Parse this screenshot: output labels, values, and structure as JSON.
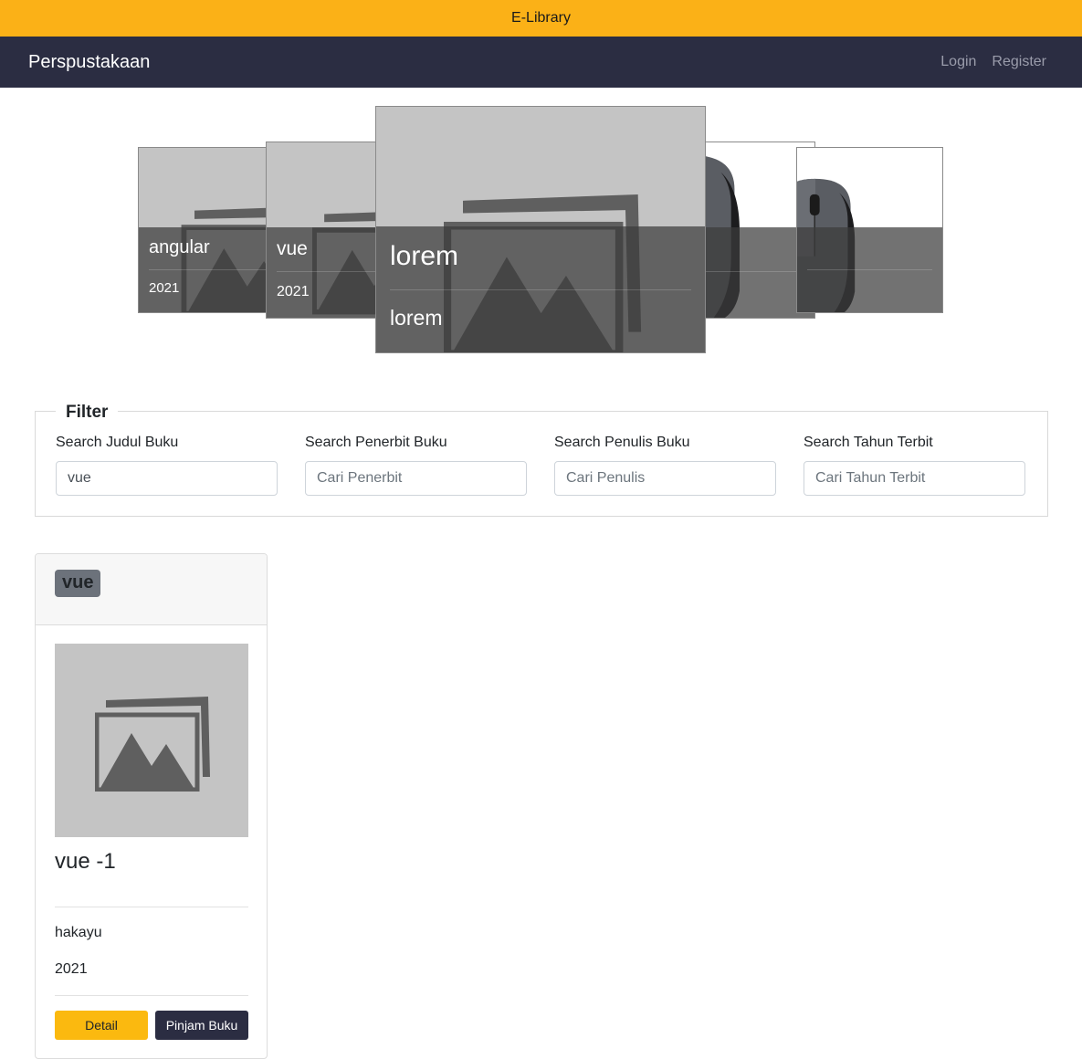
{
  "topbar": {
    "title": "E-Library"
  },
  "navbar": {
    "brand": "Perspustakaan",
    "login": "Login",
    "register": "Register"
  },
  "carousel": {
    "slides": [
      {
        "title": "angular",
        "subtitle": "2021",
        "image": "placeholder-image-icon"
      },
      {
        "title": "vue",
        "subtitle": "2021",
        "image": "placeholder-image-icon"
      },
      {
        "title": "lorem",
        "subtitle": "lorem",
        "image": "placeholder-image-icon"
      },
      {
        "title": "",
        "subtitle": "",
        "image": "computer-mouse"
      },
      {
        "title": "",
        "subtitle": "",
        "image": "computer-mouse"
      }
    ]
  },
  "filter": {
    "legend": "Filter",
    "fields": [
      {
        "label": "Search Judul Buku",
        "value": "vue",
        "placeholder": ""
      },
      {
        "label": "Search Penerbit Buku",
        "value": "",
        "placeholder": "Cari Penerbit"
      },
      {
        "label": "Search Penulis Buku",
        "value": "",
        "placeholder": "Cari Penulis"
      },
      {
        "label": "Search Tahun Terbit",
        "value": "",
        "placeholder": "Cari Tahun Terbit"
      }
    ]
  },
  "books": [
    {
      "badge": "vue",
      "title": "vue -1",
      "author": "hakayu",
      "year": "2021",
      "detail_label": "Detail",
      "borrow_label": "Pinjam Buku"
    }
  ],
  "colors": {
    "accent": "#fbb117",
    "navbar": "#2b2d42",
    "placeholder_bg": "#c4c4c4"
  }
}
